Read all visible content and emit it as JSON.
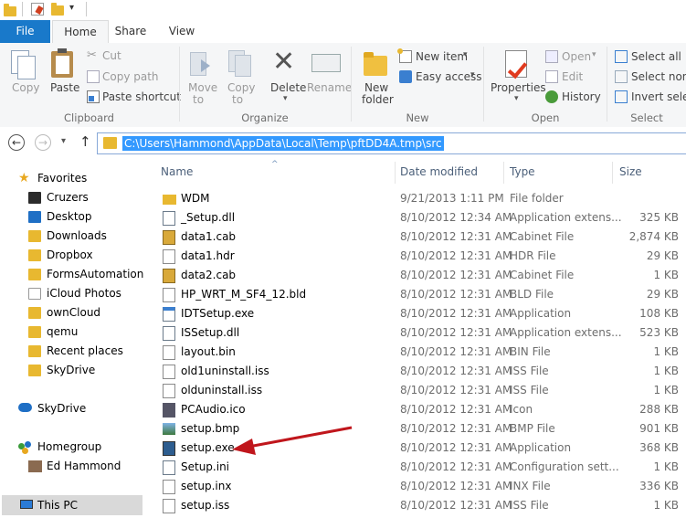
{
  "tabs": {
    "file": "File",
    "home": "Home",
    "share": "Share",
    "view": "View"
  },
  "ribbon": {
    "clipboard": {
      "copy": "Copy",
      "paste": "Paste",
      "cut": "Cut",
      "copy_path": "Copy path",
      "paste_shortcut": "Paste shortcut",
      "group": "Clipboard"
    },
    "organize": {
      "move_to_1": "Move",
      "move_to_2": "to",
      "copy_to_1": "Copy",
      "copy_to_2": "to",
      "delete": "Delete",
      "rename": "Rename",
      "group": "Organize"
    },
    "new": {
      "new_folder_1": "New",
      "new_folder_2": "folder",
      "new_item": "New item",
      "easy_access": "Easy access",
      "group": "New"
    },
    "open": {
      "properties": "Properties",
      "open": "Open",
      "edit": "Edit",
      "history": "History",
      "group": "Open"
    },
    "select": {
      "select_all": "Select all",
      "select_none": "Select none",
      "invert": "Invert select",
      "group": "Select"
    }
  },
  "address": {
    "path": "C:\\Users\\Hammond\\AppData\\Local\\Temp\\pftDD4A.tmp\\src"
  },
  "nav": {
    "favorites": "Favorites",
    "items": [
      "Cruzers",
      "Desktop",
      "Downloads",
      "Dropbox",
      "FormsAutomation",
      "iCloud Photos",
      "ownCloud",
      "qemu",
      "Recent places",
      "SkyDrive"
    ],
    "skydrive": "SkyDrive",
    "homegroup": "Homegroup",
    "user": "Ed Hammond",
    "thispc": "This PC"
  },
  "columns": {
    "name": "Name",
    "date": "Date modified",
    "type": "Type",
    "size": "Size"
  },
  "files": [
    {
      "name": "WDM",
      "date": "9/21/2013 1:11 PM",
      "type": "File folder",
      "size": "",
      "icon": "folder-icon"
    },
    {
      "name": "_Setup.dll",
      "date": "8/10/2012 12:34 AM",
      "type": "Application extens...",
      "size": "325 KB",
      "icon": "dll-icon"
    },
    {
      "name": "data1.cab",
      "date": "8/10/2012 12:31 AM",
      "type": "Cabinet File",
      "size": "2,874 KB",
      "icon": "cab-icon"
    },
    {
      "name": "data1.hdr",
      "date": "8/10/2012 12:31 AM",
      "type": "HDR File",
      "size": "29 KB",
      "icon": "file-icon"
    },
    {
      "name": "data2.cab",
      "date": "8/10/2012 12:31 AM",
      "type": "Cabinet File",
      "size": "1 KB",
      "icon": "cab-icon"
    },
    {
      "name": "HP_WRT_M_SF4_12.bld",
      "date": "8/10/2012 12:31 AM",
      "type": "BLD File",
      "size": "29 KB",
      "icon": "file-icon"
    },
    {
      "name": "IDTSetup.exe",
      "date": "8/10/2012 12:31 AM",
      "type": "Application",
      "size": "108 KB",
      "icon": "exe-icon"
    },
    {
      "name": "ISSetup.dll",
      "date": "8/10/2012 12:31 AM",
      "type": "Application extens...",
      "size": "523 KB",
      "icon": "dll-icon"
    },
    {
      "name": "layout.bin",
      "date": "8/10/2012 12:31 AM",
      "type": "BIN File",
      "size": "1 KB",
      "icon": "file-icon"
    },
    {
      "name": "old1uninstall.iss",
      "date": "8/10/2012 12:31 AM",
      "type": "ISS File",
      "size": "1 KB",
      "icon": "file-icon"
    },
    {
      "name": "olduninstall.iss",
      "date": "8/10/2012 12:31 AM",
      "type": "ISS File",
      "size": "1 KB",
      "icon": "file-icon"
    },
    {
      "name": "PCAudio.ico",
      "date": "8/10/2012 12:31 AM",
      "type": "Icon",
      "size": "288 KB",
      "icon": "ico-icon"
    },
    {
      "name": "setup.bmp",
      "date": "8/10/2012 12:31 AM",
      "type": "BMP File",
      "size": "901 KB",
      "icon": "image-icon"
    },
    {
      "name": "setup.exe",
      "date": "8/10/2012 12:31 AM",
      "type": "Application",
      "size": "368 KB",
      "icon": "setup-exe-icon"
    },
    {
      "name": "Setup.ini",
      "date": "8/10/2012 12:31 AM",
      "type": "Configuration sett...",
      "size": "1 KB",
      "icon": "ini-icon"
    },
    {
      "name": "setup.inx",
      "date": "8/10/2012 12:31 AM",
      "type": "INX File",
      "size": "336 KB",
      "icon": "file-icon"
    },
    {
      "name": "setup.iss",
      "date": "8/10/2012 12:31 AM",
      "type": "ISS File",
      "size": "1 KB",
      "icon": "file-icon"
    }
  ],
  "colors": {
    "file_tab": "#1979ca",
    "address_highlight": "#3399ff",
    "arrow": "#c0161c",
    "folder": "#e8b830"
  }
}
